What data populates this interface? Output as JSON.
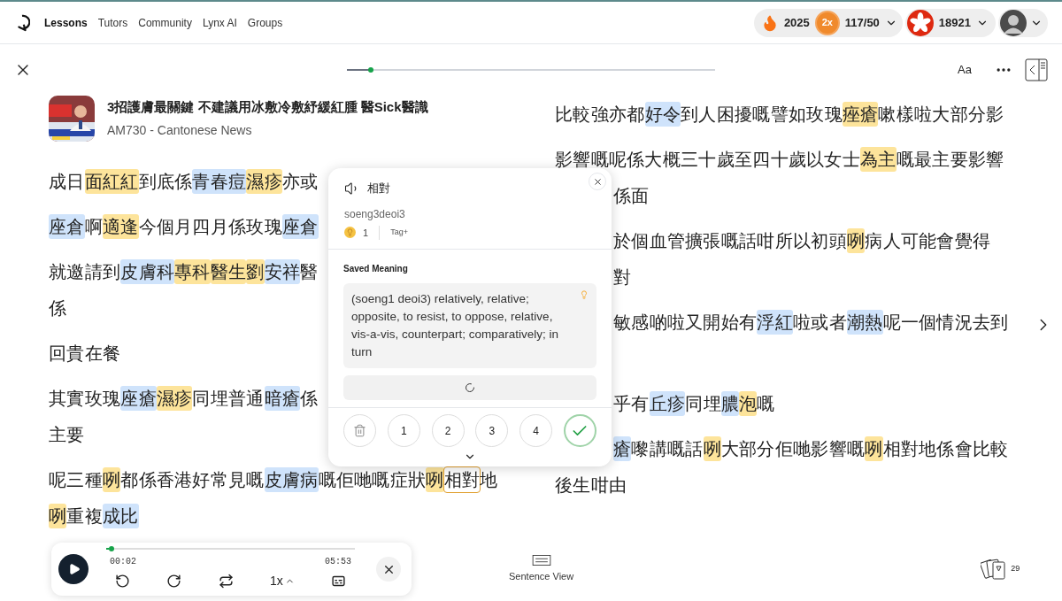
{
  "nav": {
    "links": [
      {
        "label": "Lessons",
        "selected": true
      },
      {
        "label": "Tutors",
        "selected": false
      },
      {
        "label": "Community",
        "selected": false
      },
      {
        "label": "Lynx AI",
        "selected": false
      },
      {
        "label": "Groups",
        "selected": false
      }
    ]
  },
  "stats": {
    "streak": "2025",
    "multiplier": "2x",
    "daily": "117/50",
    "coins": "18921"
  },
  "progress": {
    "level": 0.065
  },
  "toolbar": {
    "font_button": "Aa"
  },
  "lesson": {
    "title": "3招護膚最關鍵 不建議用冰敷冷敷紓緩紅腫 醫Sick醫識",
    "source": "AM730 - Cantonese News"
  },
  "left_paragraphs": [
    {
      "lines": [
        {
          "kind": "full",
          "segments": [
            {
              "text": "成日",
              "selected": false
            },
            {
              "text": "面紅紅",
              "color": "#fde49b",
              "selected": false
            },
            {
              "text": "到底係",
              "selected": false
            },
            {
              "text": "青春痘",
              "color": "#cfe3fb",
              "selected": false
            },
            {
              "text": "濕疹",
              "color": "#fde49b",
              "selected": false
            },
            {
              "text": "亦或",
              "selected": false
            }
          ]
        }
      ]
    },
    {
      "lines": [
        {
          "kind": "full",
          "segments": [
            {
              "text": "座倉",
              "color": "#cfe3fb",
              "selected": false
            },
            {
              "text": "啊",
              "selected": false
            },
            {
              "text": "適逢",
              "color": "#fde49b",
              "selected": false
            },
            {
              "text": "今個月四月係玫瑰",
              "selected": false
            },
            {
              "text": "座倉",
              "color": "#cfe3fb",
              "selected": false
            }
          ]
        }
      ]
    },
    {
      "lines": [
        {
          "kind": "full",
          "segments": [
            {
              "text": "就邀請到",
              "selected": false
            },
            {
              "text": "皮膚科",
              "color": "#cfe3fb",
              "selected": false
            },
            {
              "text": "專科",
              "color": "#fde49b",
              "selected": false
            },
            {
              "text": "醫生",
              "color": "#fde49b",
              "selected": false
            },
            {
              "text": "劉",
              "color": "#fde49b",
              "selected": false
            },
            {
              "text": "安祥",
              "color": "#cfe3fb",
              "selected": false
            },
            {
              "text": "醫",
              "selected": false
            }
          ]
        },
        {
          "kind": "full",
          "segments": [
            {
              "text": "係",
              "selected": false
            }
          ]
        }
      ]
    },
    {
      "lines": [
        {
          "kind": "full",
          "segments": [
            {
              "text": "回貴在餐",
              "selected": false
            }
          ]
        }
      ]
    },
    {
      "lines": [
        {
          "kind": "full",
          "segments": [
            {
              "text": "其實玫瑰",
              "selected": false
            },
            {
              "text": "座瘡",
              "color": "#cfe3fb",
              "selected": false
            },
            {
              "text": "濕疹",
              "color": "#fde49b",
              "selected": false
            },
            {
              "text": "同埋普通",
              "selected": false
            },
            {
              "text": "暗瘡",
              "color": "#cfe3fb",
              "selected": false
            },
            {
              "text": "係",
              "selected": false
            }
          ]
        },
        {
          "kind": "full",
          "segments": [
            {
              "text": "主要",
              "selected": false
            }
          ]
        }
      ]
    },
    {
      "lines": [
        {
          "kind": "full",
          "segments": [
            {
              "text": "呢三種",
              "selected": false
            },
            {
              "text": "咧",
              "color": "#fde49b",
              "selected": false
            },
            {
              "text": "都係香港好常見嘅",
              "selected": false
            },
            {
              "text": "皮膚病",
              "color": "#cfe3fb",
              "selected": false
            },
            {
              "text": "嘅佢哋嘅症狀",
              "selected": false
            },
            {
              "text": "咧",
              "color": "#fde49b",
              "selected": false
            },
            {
              "text": "相對",
              "selected": true
            },
            {
              "text": "地",
              "selected": false
            }
          ]
        },
        {
          "kind": "full",
          "segments": [
            {
              "text": "咧",
              "color": "#fde49b",
              "selected": false
            },
            {
              "text": "重複",
              "selected": false
            },
            {
              "text": "成比",
              "color": "#cfe3fb",
              "selected": false
            }
          ]
        }
      ]
    }
  ],
  "right_paragraphs": [
    {
      "lines": [
        {
          "kind": "full",
          "segments": [
            {
              "text": "比較強亦都",
              "selected": false
            },
            {
              "text": "好令",
              "color": "#cfe3fb",
              "selected": false
            },
            {
              "text": "到人困擾嘅譬如玫瑰",
              "selected": false
            },
            {
              "text": "痤瘡",
              "color": "#fde49b",
              "selected": false
            },
            {
              "text": "嗽樣啦大部分影",
              "selected": false
            }
          ]
        }
      ]
    },
    {
      "lines": [
        {
          "kind": "full",
          "segments": [
            {
              "text": "影響嘅呢係大概三十歲至四十歲以女士",
              "selected": false
            },
            {
              "text": "為主",
              "color": "#fde49b",
              "selected": false
            },
            {
              "text": "嘅最主要影響",
              "selected": false
            }
          ]
        },
        {
          "kind": "tail",
          "segments": [
            {
              "text": "係面",
              "selected": false
            }
          ]
        }
      ]
    },
    {
      "lines": [
        {
          "kind": "tail",
          "segments": [
            {
              "text": "於個血管擴張嘅話咁所以初頭",
              "selected": false
            },
            {
              "text": "咧",
              "color": "#fde49b",
              "selected": false
            },
            {
              "text": "病人可能會覺得",
              "selected": false
            }
          ]
        },
        {
          "kind": "tail",
          "segments": [
            {
              "text": "對",
              "selected": false
            }
          ]
        }
      ]
    },
    {
      "lines": [
        {
          "kind": "tail",
          "segments": [
            {
              "text": "敏感啲啦又開始有",
              "selected": false
            },
            {
              "text": "浮紅",
              "color": "#cfe3fb",
              "selected": false
            },
            {
              "text": "啦或者",
              "selected": false
            },
            {
              "text": "潮熱",
              "color": "#cfe3fb",
              "selected": false
            },
            {
              "text": "呢一個情況去到",
              "selected": false
            }
          ]
        },
        {
          "kind": "covered"
        }
      ]
    },
    {
      "lines": [
        {
          "kind": "tail",
          "segments": [
            {
              "text": "乎有",
              "selected": false
            },
            {
              "text": "丘疹",
              "color": "#cfe3fb",
              "selected": false
            },
            {
              "text": "同埋",
              "selected": false
            },
            {
              "text": "膿",
              "color": "#cfe3fb",
              "selected": false
            },
            {
              "text": "泡",
              "color": "#fde49b",
              "selected": false
            },
            {
              "text": "嘅",
              "selected": false
            }
          ]
        }
      ]
    },
    {
      "lines": [
        {
          "kind": "tail",
          "segments": [
            {
              "text": "瘡",
              "color": "#cfe3fb",
              "selected": false
            },
            {
              "text": "嚟講嘅話",
              "selected": false
            },
            {
              "text": "咧",
              "color": "#fde49b",
              "selected": false
            },
            {
              "text": "大部分佢哋影響嘅",
              "selected": false
            },
            {
              "text": "咧",
              "color": "#fde49b",
              "selected": false
            },
            {
              "text": "相對地係會比較",
              "selected": false
            }
          ]
        },
        {
          "kind": "full",
          "segments": [
            {
              "text": "後生咁由",
              "selected": false
            }
          ]
        }
      ]
    }
  ],
  "popup": {
    "word": "相對",
    "romanization": "soeng3deoi3",
    "count": "1",
    "tag": "Tag+",
    "heading": "Saved Meaning",
    "meaning": "(soeng1 deoi3) relatively, relative; opposite, to resist, to oppose, relative, vis-a-vis, counterpart; comparatively; in turn",
    "ratings": [
      "1",
      "2",
      "3",
      "4"
    ]
  },
  "player": {
    "elapsed": "00:02",
    "duration": "05:53",
    "level": 0.01,
    "speed": "1x"
  },
  "sentence_view": "Sentence View",
  "cards_count": "29"
}
